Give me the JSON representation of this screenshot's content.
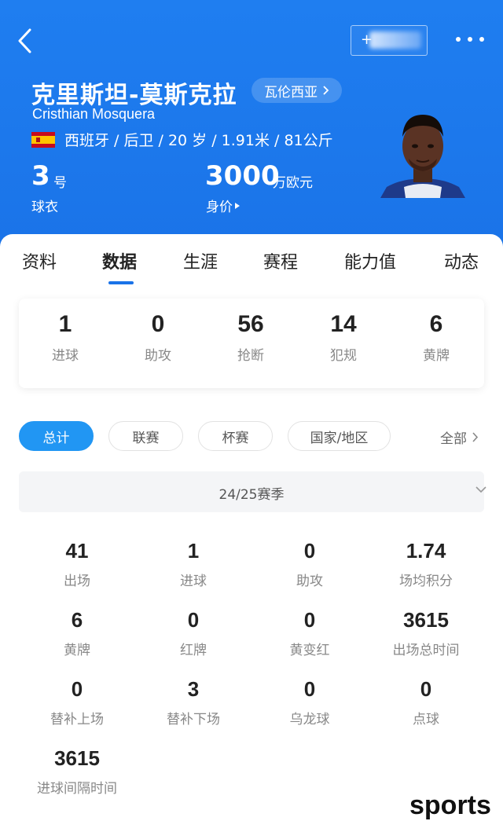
{
  "header": {
    "name_cn": "克里斯坦-莫斯克拉",
    "name_en": "Cristhian Mosquera",
    "club": "瓦伦西亚",
    "bio": "西班牙 / 后卫 / 20 岁 / 1.91米 / 81公斤",
    "shirt_number": "3",
    "shirt_unit": "号",
    "shirt_label": "球衣",
    "value": "3000",
    "value_unit": "万欧元",
    "value_label": "身价",
    "follow_label": "+"
  },
  "tabs": [
    "资料",
    "数据",
    "生涯",
    "赛程",
    "能力值",
    "动态"
  ],
  "active_tab": "数据",
  "summary": [
    {
      "value": "1",
      "label": "进球"
    },
    {
      "value": "0",
      "label": "助攻"
    },
    {
      "value": "56",
      "label": "抢断"
    },
    {
      "value": "14",
      "label": "犯规"
    },
    {
      "value": "6",
      "label": "黄牌"
    }
  ],
  "filters": {
    "chips": [
      "总计",
      "联赛",
      "杯赛",
      "国家/地区"
    ],
    "active": "总计",
    "all_label": "全部"
  },
  "season": "24/25赛季",
  "stats": [
    {
      "value": "41",
      "label": "出场"
    },
    {
      "value": "1",
      "label": "进球"
    },
    {
      "value": "0",
      "label": "助攻"
    },
    {
      "value": "1.74",
      "label": "场均积分"
    },
    {
      "value": "6",
      "label": "黄牌"
    },
    {
      "value": "0",
      "label": "红牌"
    },
    {
      "value": "0",
      "label": "黄变红"
    },
    {
      "value": "3615",
      "label": "出场总时间"
    },
    {
      "value": "0",
      "label": "替补上场"
    },
    {
      "value": "3",
      "label": "替补下场"
    },
    {
      "value": "0",
      "label": "乌龙球"
    },
    {
      "value": "0",
      "label": "点球"
    },
    {
      "value": "3615",
      "label": "进球间隔时间"
    }
  ],
  "watermark": "sports",
  "colors": {
    "accent": "#1a73e8",
    "chip_active": "#2196f3"
  }
}
